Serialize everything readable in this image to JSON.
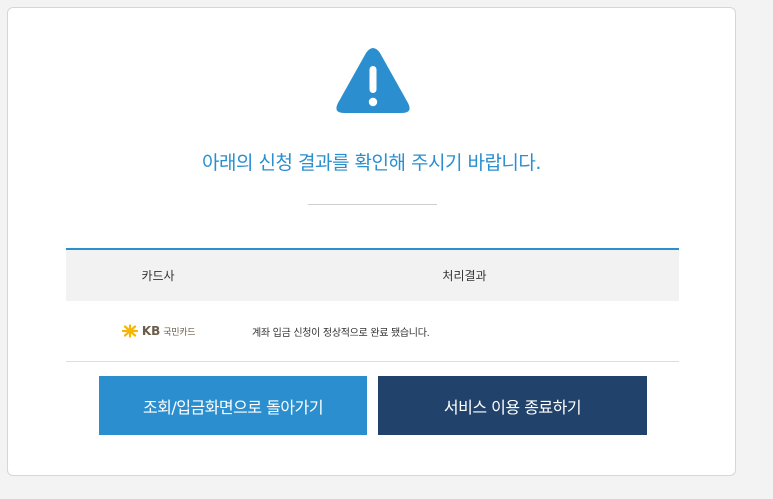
{
  "alert": {
    "icon": "warning-triangle-icon",
    "message": "아래의 신청 결과를 확인해 주시기 바랍니다."
  },
  "table": {
    "headers": [
      "카드사",
      "처리결과"
    ],
    "rows": [
      {
        "bank_logo_text": "KB",
        "bank_name": "국민카드",
        "result": "계좌 입금 신청이 정상적으로 완료 됐습니다."
      }
    ]
  },
  "buttons": {
    "back_label": "조회/입금화면으로 돌아가기",
    "exit_label": "서비스 이용 종료하기"
  },
  "colors": {
    "accent": "#2b8fcf",
    "dark": "#21436b",
    "logo_yellow": "#f5b500"
  }
}
